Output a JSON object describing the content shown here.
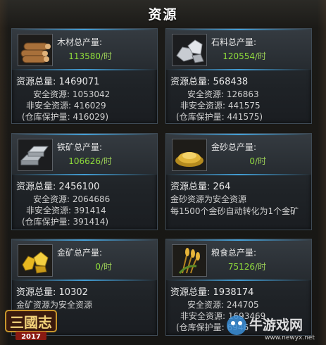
{
  "title": "资源",
  "cards": {
    "wood": {
      "icon": "wood-logs-icon",
      "label": "木材总产量:",
      "rate": "113580",
      "unit": "/时",
      "total_label": "资源总量:",
      "total": "1469071",
      "safe": "安全资源: 1053042",
      "unsafe": "非安全资源: 416029",
      "protect": "(仓库保护量: 416029)"
    },
    "stone": {
      "icon": "stone-icon",
      "label": "石料总产量:",
      "rate": "120554",
      "unit": "/时",
      "total_label": "资源总量:",
      "total": "568438",
      "safe": "安全资源: 126863",
      "unsafe": "非安全资源: 441575",
      "protect": "(仓库保护量: 441575)"
    },
    "iron": {
      "icon": "iron-ingot-icon",
      "label": "铁矿总产量:",
      "rate": "106626",
      "unit": "/时",
      "total_label": "资源总量:",
      "total": "2456100",
      "safe": "安全资源: 2064686",
      "unsafe": "非安全资源: 391414",
      "protect": "(仓库保护量: 391414)"
    },
    "goldsand": {
      "icon": "gold-sand-icon",
      "label": "金砂总产量:",
      "rate": "0",
      "unit": "/时",
      "total_label": "资源总量:",
      "total": "264",
      "note1": "金砂资源为安全资源",
      "note2": "每1500个金砂自动转化为1个金矿"
    },
    "goldore": {
      "icon": "gold-ore-icon",
      "label": "金矿总产量:",
      "rate": "0",
      "unit": "/时",
      "total_label": "资源总量:",
      "total": "10302",
      "note1": "金矿资源为安全资源"
    },
    "grain": {
      "icon": "grain-icon",
      "label": "粮食总产量:",
      "rate": "75126",
      "unit": "/时",
      "total_label": "资源总量:",
      "total": "1938174",
      "safe": "安全资源: 244705",
      "unsafe": "非安全资源: 1693469",
      "protect": "(仓库保护量: 6946"
    }
  },
  "logo": {
    "text": "三国志",
    "year": "2017"
  },
  "watermark": {
    "text": "牛游戏网",
    "url": "www.newyx.net"
  },
  "colors": {
    "accent": "#8fdc3a",
    "glow": "#46aae6",
    "title": "#ffffff"
  }
}
